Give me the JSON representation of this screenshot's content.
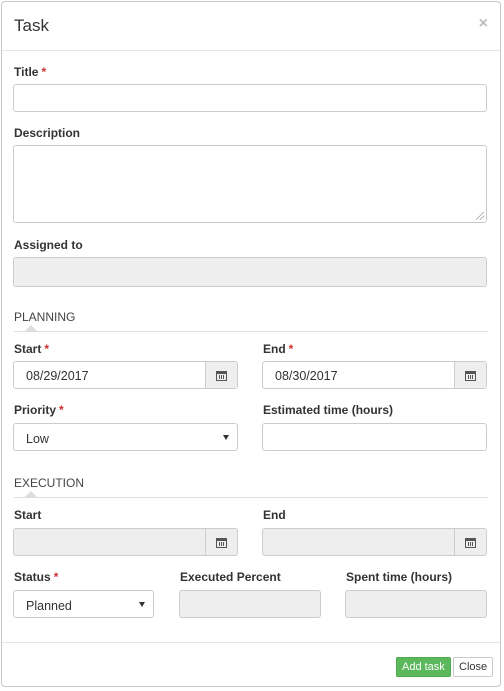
{
  "modal": {
    "title": "Task",
    "close_symbol": "×"
  },
  "form": {
    "title_label": "Title",
    "required_marker": "*",
    "description_label": "Description",
    "assigned_label": "Assigned to",
    "planning_section": "PLANNING",
    "start_label": "Start",
    "end_label": "End",
    "start_value": "08/29/2017",
    "end_value": "08/30/2017",
    "priority_label": "Priority",
    "priority_value": "Low",
    "estimated_label": "Estimated time (hours)",
    "execution_section": "EXECUTION",
    "exec_start_label": "Start",
    "exec_end_label": "End",
    "status_label": "Status",
    "status_value": "Planned",
    "executed_percent_label": "Executed Percent",
    "spent_time_label": "Spent time (hours)"
  },
  "footer": {
    "add_task": "Add task",
    "close": "Close"
  },
  "icons": {
    "calendar": "calendar-icon",
    "dropdown": "chevron-down-icon",
    "close": "close-icon"
  },
  "colors": {
    "primary_button": "#5cb85c",
    "required": "#c9302c",
    "disabled_field": "#eeeeee"
  }
}
